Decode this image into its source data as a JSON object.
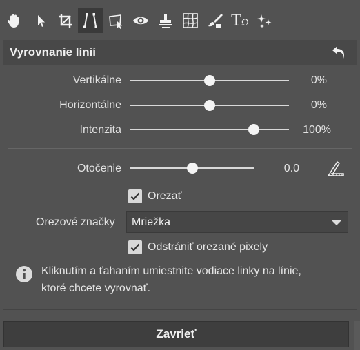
{
  "toolbar": {
    "tools": [
      {
        "icon": "hand-icon"
      },
      {
        "icon": "pointer-icon"
      },
      {
        "icon": "crop-icon"
      },
      {
        "icon": "line-align-icon",
        "active": true
      },
      {
        "icon": "transform-icon"
      },
      {
        "icon": "eye-icon"
      },
      {
        "icon": "stamp-icon"
      },
      {
        "icon": "mesh-icon"
      },
      {
        "icon": "brush-icon"
      },
      {
        "icon": "text-icon",
        "text": "T",
        "sub": "Ω"
      },
      {
        "icon": "sparkle-icon"
      }
    ]
  },
  "section": {
    "title": "Vyrovnanie línií",
    "reset_icon": "undo-arrow-icon"
  },
  "sliders": [
    {
      "label": "Vertikálne",
      "value_text": "0%",
      "fraction": 0.5
    },
    {
      "label": "Horizontálne",
      "value_text": "0%",
      "fraction": 0.5
    },
    {
      "label": "Intenzita",
      "value_text": "100%",
      "fraction": 0.78
    }
  ],
  "rotation": {
    "label": "Otočenie",
    "value_text": "0.0",
    "fraction": 0.5,
    "tool_icon": "ruler-icon"
  },
  "crop": {
    "label": "Orezať",
    "checked": true
  },
  "crop_marks": {
    "label": "Orezové značky",
    "selected": "Mriežka"
  },
  "remove_cropped": {
    "label": "Odstrániť orezané pixely",
    "checked": true
  },
  "info": {
    "icon": "info-icon",
    "text_line1": "Kliknutím a ťahaním umiestnite vodiace linky na línie,",
    "text_line2": "ktoré chcete vyrovnať."
  },
  "close_label": "Zavrieť",
  "colors": {
    "background": "#525252",
    "header": "#484848",
    "active_tool": "#3a3a3a",
    "text": "#e6e6e6"
  }
}
